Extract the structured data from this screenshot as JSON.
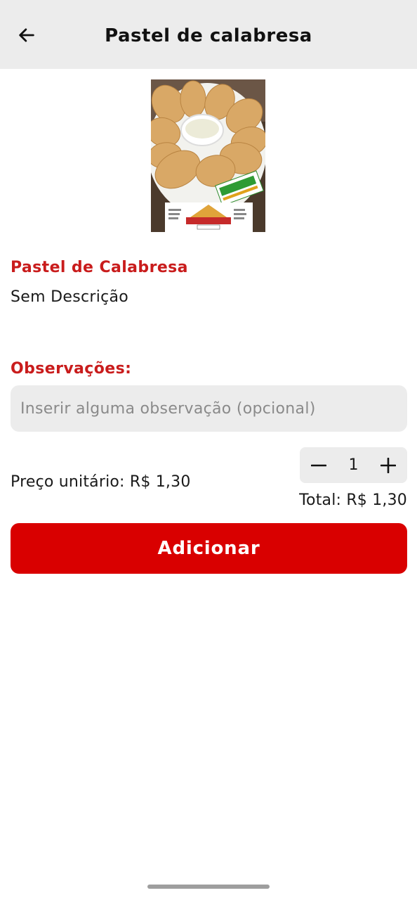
{
  "header": {
    "title": "Pastel de calabresa",
    "back_icon": "arrow-left-icon"
  },
  "product": {
    "image_alt": "pastries-photo",
    "name": "Pastel de Calabresa",
    "description": "Sem Descrição"
  },
  "observations": {
    "label": "Observações:",
    "placeholder": "Inserir alguma observação (opcional)",
    "value": ""
  },
  "pricing": {
    "unit_price": "Preço unitário: R$ 1,30",
    "quantity": "1",
    "total": "Total: R$ 1,30"
  },
  "actions": {
    "add_label": "Adicionar"
  },
  "colors": {
    "accent": "#c91c1c",
    "button": "#d90000",
    "surface": "#ececec"
  }
}
